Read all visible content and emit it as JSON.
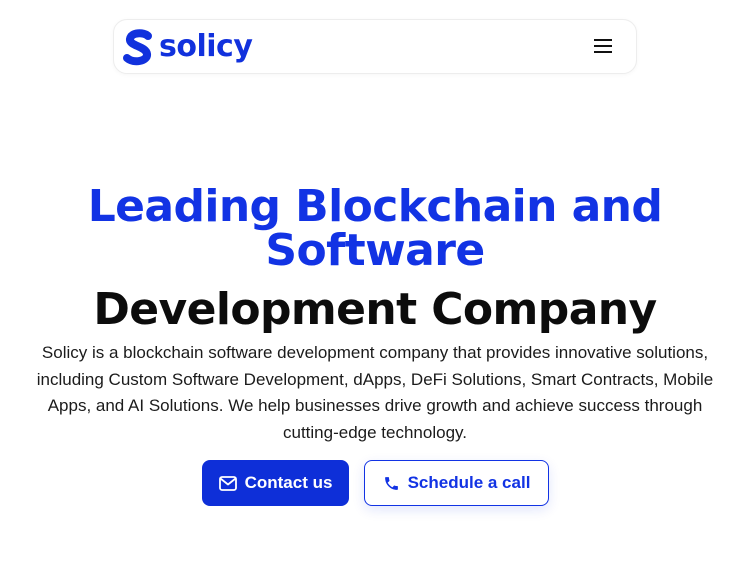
{
  "brand": {
    "name": "solicy",
    "color": "#1131dd"
  },
  "nav": {
    "menu_icon": "hamburger-menu-icon"
  },
  "hero": {
    "title_blue": "Leading Blockchain and Software",
    "title_dark": "Development Company",
    "description": "Solicy is a blockchain software development company that provides innovative solutions, including Custom Software Development, dApps, DeFi Solutions, Smart Contracts, Mobile Apps, and AI Solutions. We help businesses drive growth and achieve success through cutting-edge technology.",
    "title_blue_color": "#1233e4",
    "title_dark_color": "#0c0c0c"
  },
  "buttons": {
    "contact_label": "Contact us",
    "contact_icon": "mail-icon",
    "schedule_label": "Schedule a call",
    "schedule_icon": "phone-icon",
    "primary_color": "#0e2fd8"
  }
}
